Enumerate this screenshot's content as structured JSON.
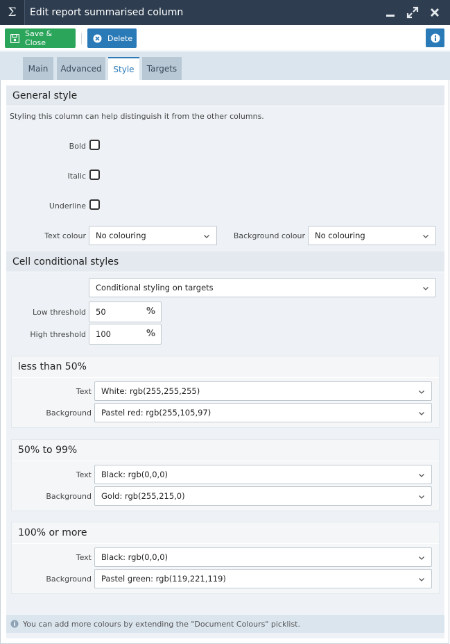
{
  "window": {
    "icon_glyph": "Σ",
    "title": "Edit report summarised column",
    "controls": [
      "minimize-icon",
      "maximize-icon",
      "close-icon"
    ]
  },
  "toolbar": {
    "save_label": "Save & Close",
    "delete_label": "Delete",
    "save_color": "#2aa55a",
    "delete_color": "#2a7ab8"
  },
  "tabs": [
    {
      "label": "Main",
      "active": false
    },
    {
      "label": "Advanced",
      "active": false
    },
    {
      "label": "Style",
      "active": true
    },
    {
      "label": "Targets",
      "active": false
    }
  ],
  "general": {
    "heading": "General style",
    "description": "Styling this column can help distinguish it from the other columns.",
    "bold_label": "Bold",
    "bold_checked": false,
    "italic_label": "Italic",
    "italic_checked": false,
    "underline_label": "Underline",
    "underline_checked": false,
    "text_colour_label": "Text colour",
    "text_colour_value": "No colouring",
    "background_colour_label": "Background colour",
    "background_colour_value": "No colouring"
  },
  "conditional": {
    "heading": "Cell conditional styles",
    "mode_value": "Conditional styling on targets",
    "low_label": "Low threshold",
    "low_value": "50",
    "high_label": "High threshold",
    "high_value": "100",
    "percent_symbol": "%",
    "bands": [
      {
        "title": "less than 50%",
        "text_label": "Text",
        "text_value": "White: rgb(255,255,255)",
        "background_label": "Background",
        "background_value": "Pastel red: rgb(255,105,97)"
      },
      {
        "title": "50% to 99%",
        "text_label": "Text",
        "text_value": "Black: rgb(0,0,0)",
        "background_label": "Background",
        "background_value": "Gold: rgb(255,215,0)"
      },
      {
        "title": "100% or more",
        "text_label": "Text",
        "text_value": "Black: rgb(0,0,0)",
        "background_label": "Background",
        "background_value": "Pastel green: rgb(119,221,119)"
      }
    ]
  },
  "info_message": "You can add more colours by extending the \"Document Colours\" picklist."
}
